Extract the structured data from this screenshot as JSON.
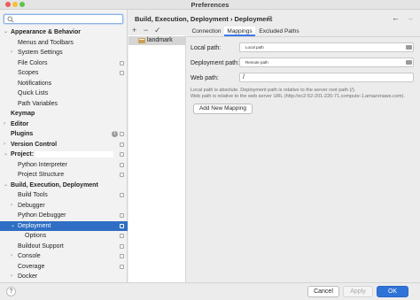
{
  "window": {
    "title": "Preferences"
  },
  "search": {
    "placeholder": ""
  },
  "sidebar": {
    "items": [
      {
        "label": "Appearance & Behavior",
        "bold": true,
        "expanded": true,
        "settings": false
      },
      {
        "label": "Menus and Toolbars",
        "settings": false
      },
      {
        "label": "System Settings",
        "collapsed": true,
        "settings": false
      },
      {
        "label": "File Colors",
        "settings": true
      },
      {
        "label": "Scopes",
        "settings": true
      },
      {
        "label": "Notifications",
        "settings": false
      },
      {
        "label": "Quick Lists",
        "settings": false
      },
      {
        "label": "Path Variables",
        "settings": false
      },
      {
        "label": "Keymap",
        "bold": true,
        "settings": false
      },
      {
        "label": "Editor",
        "bold": true,
        "collapsed": true,
        "settings": false
      },
      {
        "label": "Plugins",
        "bold": true,
        "settings": true,
        "badge": "1"
      },
      {
        "label": "Version Control",
        "bold": true,
        "collapsed": true,
        "settings": true
      },
      {
        "label": "Project:",
        "bold": true,
        "expanded": true,
        "settings": true
      },
      {
        "label": "Python Interpreter",
        "settings": true
      },
      {
        "label": "Project Structure",
        "settings": true
      },
      {
        "label": "Build, Execution, Deployment",
        "bold": true,
        "expanded": true,
        "settings": false
      },
      {
        "label": "Build Tools",
        "settings": true
      },
      {
        "label": "Debugger",
        "collapsed": true,
        "settings": false
      },
      {
        "label": "Python Debugger",
        "settings": true
      },
      {
        "label": "Deployment",
        "expanded": true,
        "selected": true,
        "settings": true
      },
      {
        "label": "Options",
        "settings": true
      },
      {
        "label": "Buildout Support",
        "settings": true
      },
      {
        "label": "Console",
        "collapsed": true,
        "settings": true
      },
      {
        "label": "Coverage",
        "settings": true
      },
      {
        "label": "Docker",
        "collapsed": true,
        "settings": false
      }
    ]
  },
  "header": {
    "breadcrumb": "Build, Execution, Deployment  ›  Deployment",
    "back_icon": "arrow-left-icon",
    "forward_icon": "arrow-right-icon"
  },
  "servers": {
    "toolbar": [
      "+",
      "−",
      "✓"
    ],
    "items": [
      {
        "label": "landmark"
      }
    ]
  },
  "tabs": [
    {
      "label": "Connection",
      "active": false
    },
    {
      "label": "Mappings",
      "active": true
    },
    {
      "label": "Excluded Paths",
      "active": false
    }
  ],
  "form": {
    "local_path_label": "Local path:",
    "local_path_value": "Local path",
    "deployment_path_label": "Deployment path:",
    "deployment_path_value": "Remote path",
    "web_path_label": "Web path:",
    "web_path_value": "/",
    "hint_line1": "Local path is absolute. Deployment path is relative to the server root path (/).",
    "hint_line2": "Web path is relative to the web server URL (http://ec2-52-201-220-71.compute-1.amazonaws.com).",
    "add_mapping_label": "Add New Mapping"
  },
  "footer": {
    "help_label": "?",
    "cancel_label": "Cancel",
    "apply_label": "Apply",
    "ok_label": "OK"
  },
  "colors": {
    "selection": "#2f6ec4",
    "ok_button": "#2f73d8",
    "tab_underline": "#3b78e7"
  }
}
